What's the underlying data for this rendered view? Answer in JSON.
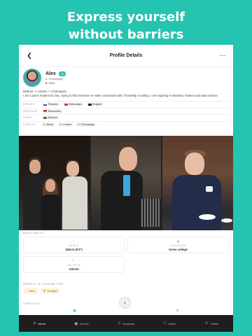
{
  "headline": {
    "line1": "Express yourself",
    "line2": "without barriers"
  },
  "topbar": {
    "title": "Profile Details",
    "back_icon": "back-icon",
    "more_icon": "more-icon"
  },
  "profile": {
    "name": "Alex",
    "age": "22",
    "location": "Champaign",
    "study": "Stats",
    "bio": "Belarus -> London -> Champaign\nI am a junior student at Uiuc, trying to find someone to make connection with. friendship or dating. I am majoring in statistics, finance and data science."
  },
  "details": [
    {
      "label": "SPEAKS",
      "chips": [
        "Russian",
        "Belarusian",
        "English"
      ]
    },
    {
      "label": "HERITAGE",
      "chips": [
        "Belarusian"
      ]
    },
    {
      "label": "FROM",
      "chips": [
        "Belarus"
      ]
    },
    {
      "label": "LIVED IN",
      "chips": [
        "Minsk",
        "London",
        "Champaign"
      ]
    }
  ],
  "basic_facts": {
    "label": "BASIC FACTS",
    "items": [
      {
        "key": "HEIGHT",
        "value": "183cm (6'0\")"
      },
      {
        "key": "EDUCATION",
        "value": "Some college"
      },
      {
        "key": "RELIGION",
        "value": "Atheist"
      }
    ]
  },
  "identity": {
    "label": "IDENTITY & LOOKING FOR",
    "chips": [
      "Men",
      "Straight"
    ]
  },
  "lifestyle": {
    "label": "LIFESTYLE"
  },
  "tabs": [
    {
      "label": "Home",
      "icon": "home-icon"
    },
    {
      "label": "Events",
      "icon": "compass-icon"
    },
    {
      "label": "Requests",
      "icon": "bell-icon"
    },
    {
      "label": "Chats",
      "icon": "chat-icon"
    },
    {
      "label": "Profile",
      "icon": "profile-icon"
    }
  ],
  "colors": {
    "brand": "#25c4b0",
    "tabbar": "#1e1e1e"
  }
}
